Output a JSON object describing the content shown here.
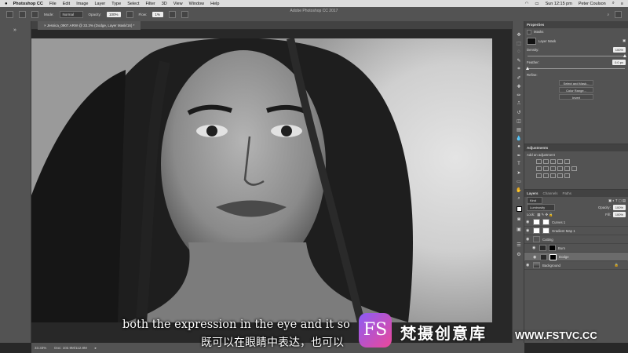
{
  "menubar": {
    "app": "Photoshop CC",
    "items": [
      "File",
      "Edit",
      "Image",
      "Layer",
      "Type",
      "Select",
      "Filter",
      "3D",
      "View",
      "Window",
      "Help"
    ],
    "clock": "Sun 12:15 pm",
    "user": "Peter Coulson"
  },
  "options": {
    "window_title": "Adobe Photoshop CC 2017",
    "mode_label": "Mode:",
    "mode_value": "Normal",
    "opacity_label": "Opacity:",
    "opacity_value": "100%",
    "flow_label": "Flow:",
    "flow_value": "1%"
  },
  "document": {
    "tab_title": "Jessica_0907.ARW @ 33.3% (Dodge, Layer Mask/16) *"
  },
  "properties": {
    "tab": "Properties",
    "masks_label": "Masks",
    "layer_mask_label": "Layer Mask",
    "density_label": "Density:",
    "density_value": "100%",
    "feather_label": "Feather:",
    "feather_value": "0.0 px",
    "density_fraction": 1.0,
    "feather_fraction": 0.0,
    "refine_label": "Refine:",
    "buttons": [
      "Select and Mask...",
      "Color Range...",
      "Invert"
    ]
  },
  "adjustments": {
    "tab": "Adjustments",
    "subtitle": "Add an adjustment"
  },
  "layers": {
    "tabs": [
      "Layers",
      "Channels",
      "Paths"
    ],
    "kind_label": "Kind",
    "blend_mode": "Luminosity",
    "opacity_label": "Opacity:",
    "opacity_value": "100%",
    "lock_label": "Lock:",
    "fill_label": "Fill:",
    "fill_value": "100%",
    "items": [
      {
        "name": "Curves 1",
        "thumb": "white"
      },
      {
        "name": "Gradient Map 1",
        "thumb": "white"
      },
      {
        "name": "Cutting",
        "thumb": "none"
      },
      {
        "name": "Burn",
        "thumb": "black"
      },
      {
        "name": "Dodge",
        "thumb": "black"
      },
      {
        "name": "Background",
        "thumb": "photo"
      }
    ]
  },
  "status": {
    "zoom": "33.33%",
    "doc_info": "Doc: 102.9M/112.8M"
  },
  "subtitles": {
    "english": "both the expression in the eye and it so",
    "chinese": "既可以在眼睛中表达，也可以"
  },
  "watermark": {
    "logo_text": "FS",
    "name_cn": "梵摄创意库",
    "url": "WWW.FSTVC.CC"
  }
}
